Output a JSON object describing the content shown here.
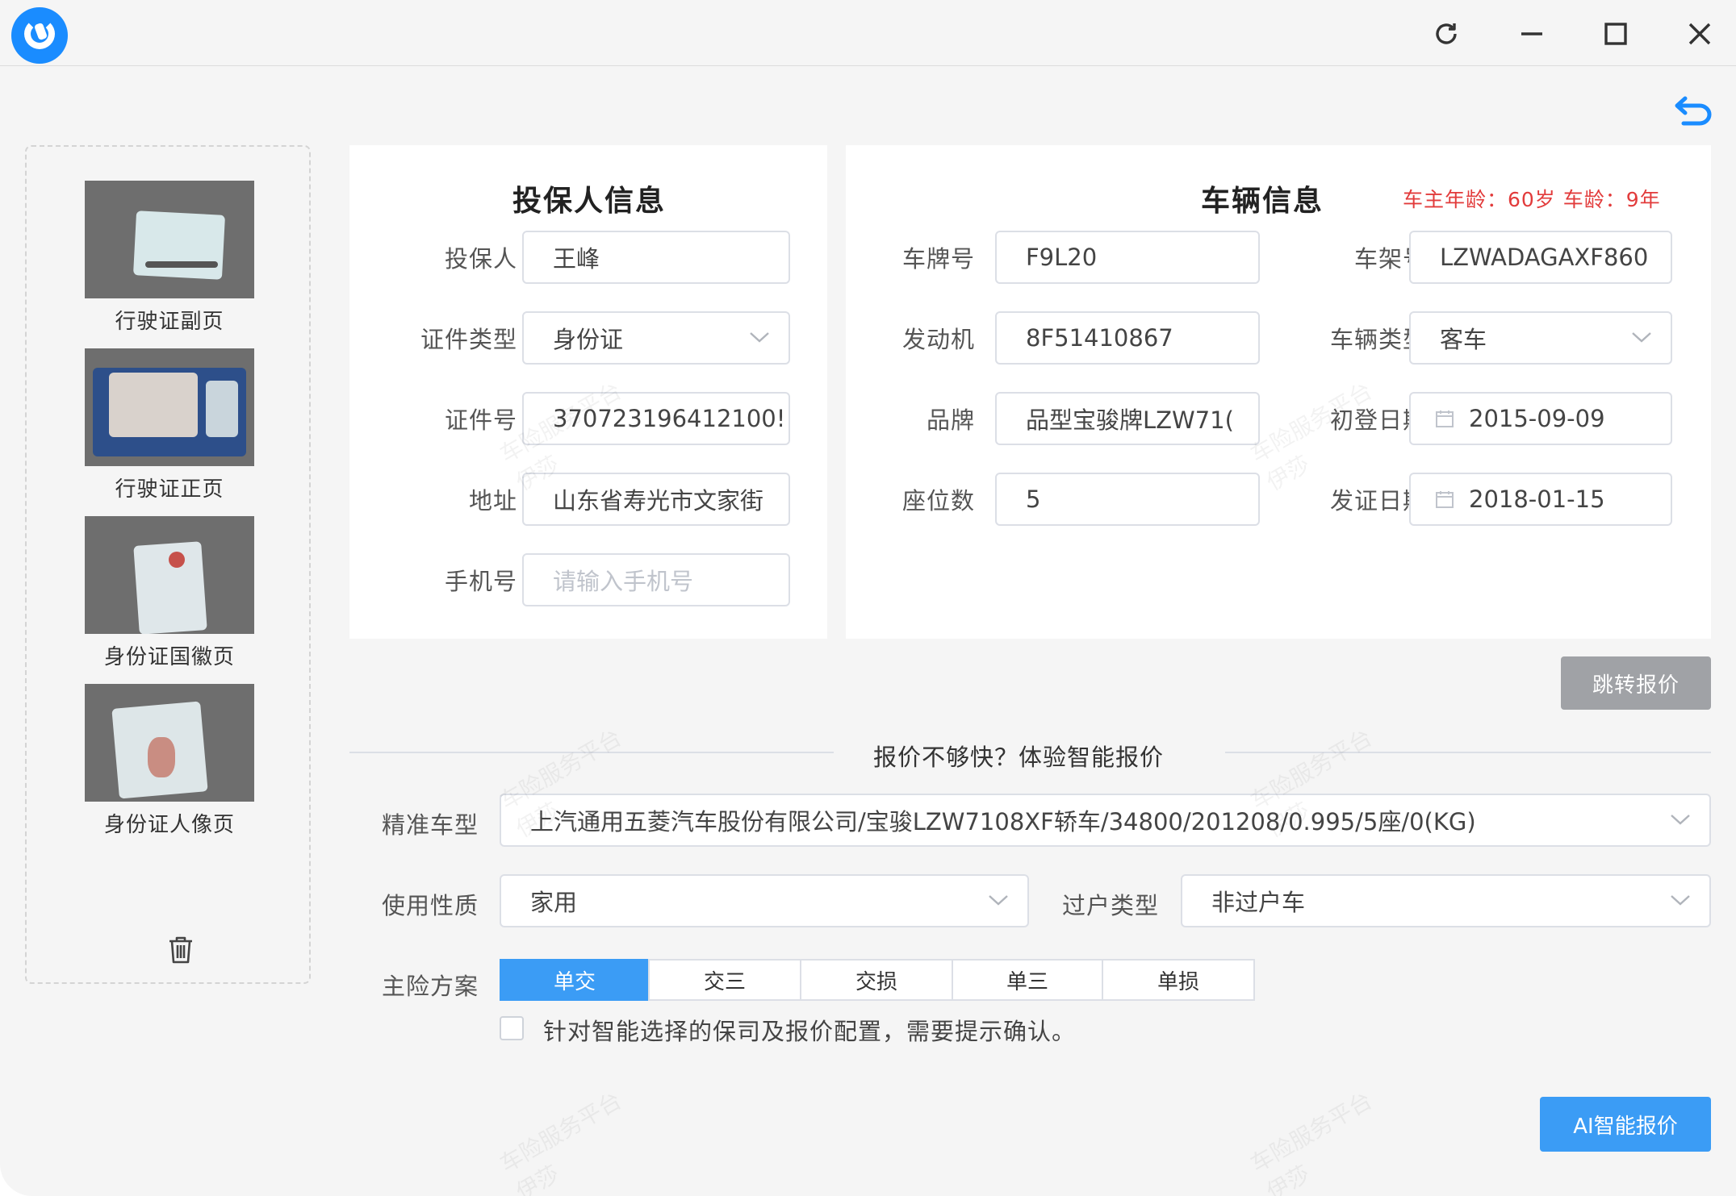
{
  "colors": {
    "accent": "#3b9cf5",
    "warning_text": "#e23b3b",
    "gray_button": "#a0a2a6"
  },
  "titlebar": {
    "icons": [
      "app-logo",
      "refresh-icon",
      "minimize-icon",
      "maximize-icon",
      "close-icon"
    ]
  },
  "thumbnails": [
    {
      "caption": "行驶证副页"
    },
    {
      "caption": "行驶证正页"
    },
    {
      "caption": "身份证国徽页"
    },
    {
      "caption": "身份证人像页"
    }
  ],
  "applicant": {
    "title": "投保人信息",
    "fields": {
      "name": {
        "label": "投保人",
        "value": "王峰"
      },
      "id_type": {
        "label": "证件类型",
        "value": "身份证"
      },
      "id_number": {
        "label": "证件号",
        "value": "370723196412100!"
      },
      "address": {
        "label": "地址",
        "value": "山东省寿光市文家街"
      },
      "phone": {
        "label": "手机号",
        "placeholder": "请输入手机号"
      }
    }
  },
  "vehicle": {
    "title": "车辆信息",
    "age_info": "车主年龄：60岁 车龄：9年",
    "fields": {
      "plate": {
        "label": "车牌号",
        "value": "F9L20"
      },
      "vin": {
        "label": "车架号",
        "value": "LZWADAGAXF860"
      },
      "engine": {
        "label": "发动机",
        "value": "8F51410867"
      },
      "type": {
        "label": "车辆类型",
        "value": "客车"
      },
      "brand": {
        "label": "品牌",
        "value": "品型宝骏牌LZW71("
      },
      "first_reg": {
        "label": "初登日期",
        "value": "2015-09-09"
      },
      "seats": {
        "label": "座位数",
        "value": "5"
      },
      "issue_date": {
        "label": "发证日期",
        "value": "2018-01-15"
      }
    }
  },
  "jump_quote_button": "跳转报价",
  "smart": {
    "divider_text": "报价不够快？体验智能报价",
    "model": {
      "label": "精准车型",
      "value": "上汽通用五菱汽车股份有限公司/宝骏LZW7108XF轿车/34800/201208/0.995/5座/0(KG)"
    },
    "usage": {
      "label": "使用性质",
      "value": "家用"
    },
    "transfer": {
      "label": "过户类型",
      "value": "非过户车"
    },
    "plan": {
      "label": "主险方案",
      "options": [
        "单交",
        "交三",
        "交损",
        "单三",
        "单损"
      ],
      "selected": "单交"
    },
    "confirm_text": "针对智能选择的保司及报价配置，需要提示确认。",
    "ai_button": "AI智能报价"
  },
  "watermark": {
    "line1": "车险服务平台",
    "line2": "伊莎"
  }
}
